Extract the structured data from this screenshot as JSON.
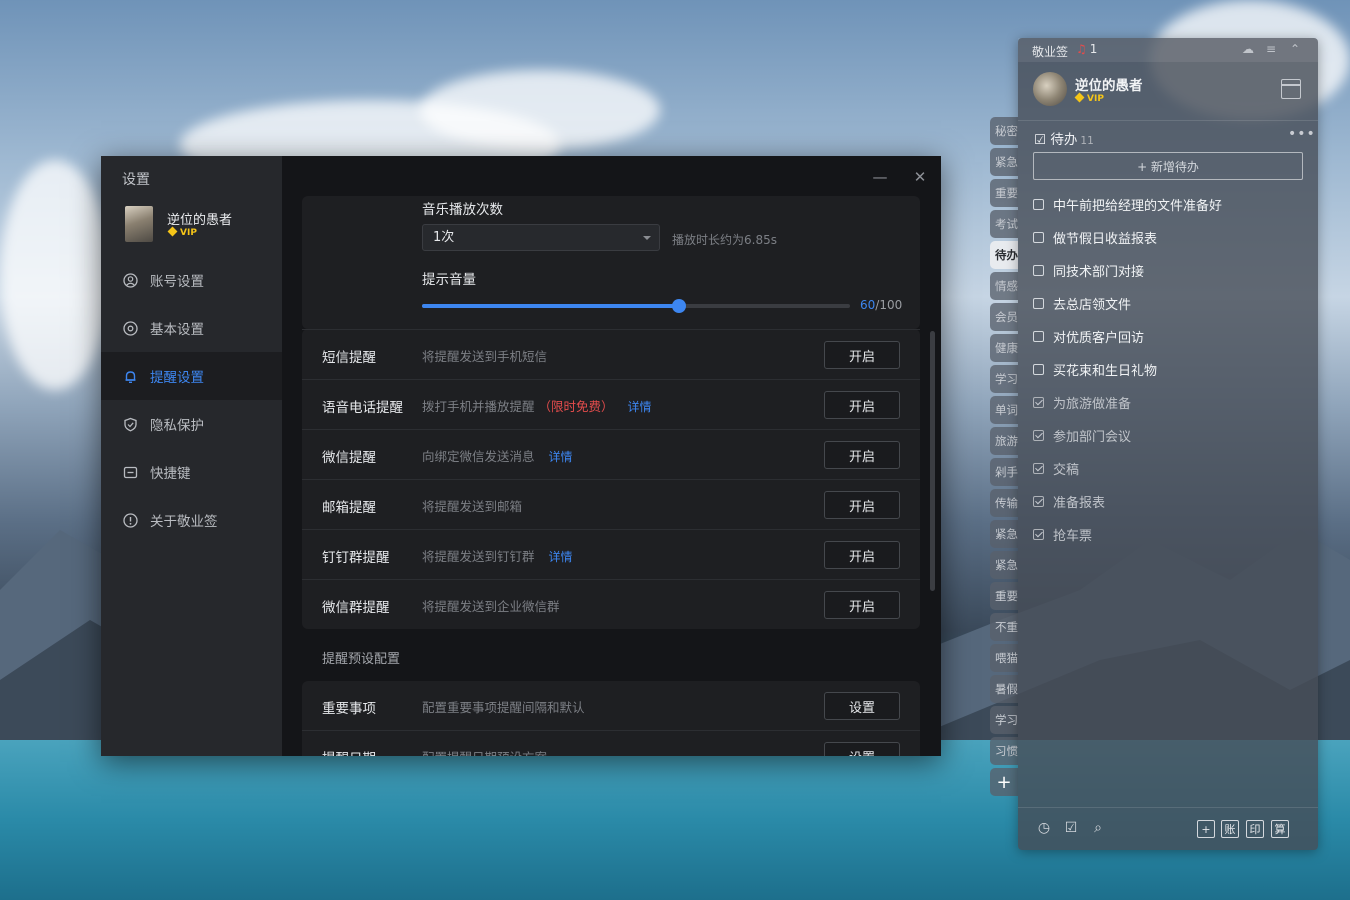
{
  "settings_window": {
    "title": "设置",
    "user": {
      "name": "逆位的愚者",
      "vip": "VIP"
    },
    "nav": [
      {
        "label": "账号设置",
        "icon": "user-circle-icon"
      },
      {
        "label": "基本设置",
        "icon": "gear-icon"
      },
      {
        "label": "提醒设置",
        "icon": "bell-icon",
        "active": true
      },
      {
        "label": "隐私保护",
        "icon": "shield-icon"
      },
      {
        "label": "快捷键",
        "icon": "keyboard-icon"
      },
      {
        "label": "关于敬业签",
        "icon": "info-icon"
      }
    ],
    "controls": {
      "minimize": "—",
      "close": "✕"
    },
    "music": {
      "play_count_label": "音乐播放次数",
      "play_count_value": "1次",
      "duration_hint": "播放时长约为6.85s",
      "volume_label": "提示音量",
      "volume_value": 60,
      "volume_max": "/100"
    },
    "reminders": [
      {
        "title": "短信提醒",
        "desc": "将提醒发送到手机短信",
        "button": "开启"
      },
      {
        "title": "语音电话提醒",
        "desc": "拨打手机并播放提醒",
        "free": "（限时免费）",
        "detail": "详情",
        "button": "开启"
      },
      {
        "title": "微信提醒",
        "desc": "向绑定微信发送消息",
        "detail": "详情",
        "button": "开启"
      },
      {
        "title": "邮箱提醒",
        "desc": "将提醒发送到邮箱",
        "button": "开启"
      },
      {
        "title": "钉钉群提醒",
        "desc": "将提醒发送到钉钉群",
        "detail": "详情",
        "button": "开启"
      },
      {
        "title": "微信群提醒",
        "desc": "将提醒发送到企业微信群",
        "button": "开启"
      }
    ],
    "preset_section_label": "提醒预设配置",
    "presets": [
      {
        "title": "重要事项",
        "desc": "配置重要事项提醒间隔和默认",
        "button": "设置"
      },
      {
        "title": "提醒日期",
        "desc": "配置提醒日期预设方案",
        "button": "设置"
      }
    ]
  },
  "side_tabs": [
    "秘密",
    "紧急",
    "重要",
    "考试",
    "待办",
    "情感",
    "会员",
    "健康",
    "学习",
    "单词",
    "旅游",
    "剁手",
    "传输",
    "紧急",
    "紧急",
    "重要",
    "不重",
    "喂猫",
    "暑假",
    "学习",
    "习惯"
  ],
  "side_tabs_active_index": 4,
  "side_add": "+",
  "widget": {
    "app_name": "敬业签",
    "notification_count": "1",
    "user": {
      "name": "逆位的愚者",
      "vip": "VIP"
    },
    "section_title": "待办",
    "section_count": "11",
    "more": "•••",
    "add_button": "+ 新增待办",
    "todos": [
      {
        "text": "中午前把给经理的文件准备好",
        "done": false
      },
      {
        "text": "做节假日收益报表",
        "done": false
      },
      {
        "text": "同技术部门对接",
        "done": false
      },
      {
        "text": "去总店领文件",
        "done": false
      },
      {
        "text": "对优质客户回访",
        "done": false
      },
      {
        "text": "买花束和生日礼物",
        "done": false
      },
      {
        "text": "为旅游做准备",
        "done": true
      },
      {
        "text": "参加部门会议",
        "done": true
      },
      {
        "text": "交稿",
        "done": true
      },
      {
        "text": "准备报表",
        "done": true
      },
      {
        "text": "抢车票",
        "done": true
      }
    ],
    "bottom_buttons": [
      "+",
      "账",
      "印",
      "算"
    ]
  },
  "colors": {
    "accent": "#3d86f0",
    "danger": "#e34c4c",
    "vip": "#f5c518"
  }
}
